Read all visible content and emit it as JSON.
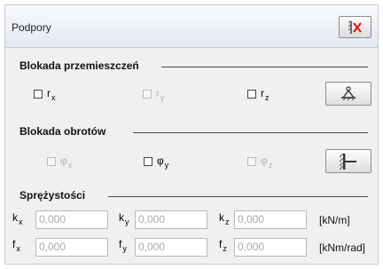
{
  "window": {
    "title": "Podpory",
    "close_icon": "support-remove-icon"
  },
  "translation_lock": {
    "title": "Blokada przemieszczeń",
    "checkboxes": [
      {
        "symbol": "r",
        "sub": "x",
        "checked": false,
        "enabled": true
      },
      {
        "symbol": "r",
        "sub": "y",
        "checked": false,
        "enabled": false
      },
      {
        "symbol": "r",
        "sub": "z",
        "checked": false,
        "enabled": true
      }
    ],
    "button_icon": "pinned-support-icon"
  },
  "rotation_lock": {
    "title": "Blokada obrotów",
    "checkboxes": [
      {
        "symbol": "φ",
        "sub": "x",
        "checked": false,
        "enabled": false
      },
      {
        "symbol": "φ",
        "sub": "y",
        "checked": false,
        "enabled": true
      },
      {
        "symbol": "φ",
        "sub": "z",
        "checked": false,
        "enabled": false
      }
    ],
    "button_icon": "fixed-support-icon"
  },
  "elasticity": {
    "title": "Sprężystości",
    "rows": [
      {
        "unit": "[kN/m]",
        "fields": [
          {
            "symbol": "k",
            "sub": "x",
            "value": "0,000"
          },
          {
            "symbol": "k",
            "sub": "y",
            "value": "0,000"
          },
          {
            "symbol": "k",
            "sub": "z",
            "value": "0,000"
          }
        ]
      },
      {
        "unit": "[kNm/rad]",
        "fields": [
          {
            "symbol": "f",
            "sub": "x",
            "value": "0,000"
          },
          {
            "symbol": "f",
            "sub": "y",
            "value": "0,000"
          },
          {
            "symbol": "f",
            "sub": "z",
            "value": "0,000"
          }
        ]
      }
    ]
  }
}
